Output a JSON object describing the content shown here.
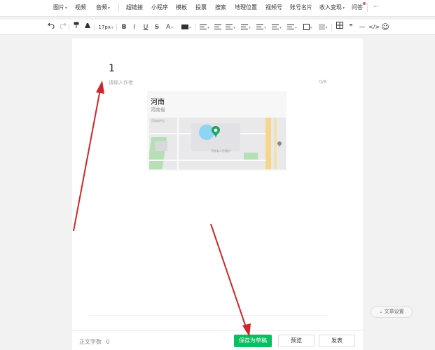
{
  "menu": {
    "items": [
      {
        "label": "图片",
        "dropdown": true
      },
      {
        "label": "视频",
        "dropdown": false
      },
      {
        "label": "音频",
        "dropdown": true
      },
      {
        "label": "超链接",
        "dropdown": false
      },
      {
        "label": "小程序",
        "dropdown": false
      },
      {
        "label": "模板",
        "dropdown": false
      },
      {
        "label": "投票",
        "dropdown": false
      },
      {
        "label": "搜索",
        "dropdown": false
      },
      {
        "label": "地理位置",
        "dropdown": false
      },
      {
        "label": "视频号",
        "dropdown": false
      },
      {
        "label": "账号名片",
        "dropdown": false
      },
      {
        "label": "收入变现",
        "dropdown": true
      },
      {
        "label": "问答",
        "dropdown": false
      },
      {
        "label": "···",
        "dropdown": false
      }
    ]
  },
  "toolbar": {
    "undo_icon": "undo-icon",
    "redo_icon": "redo-icon",
    "format_painter_icon": "format-painter-icon",
    "clear_format_icon": "clear-format-icon",
    "font_size": "17px",
    "bold": "B",
    "italic": "I",
    "underline": "U",
    "strike": "S",
    "font_color": "A",
    "quote": "❞",
    "dash": "—",
    "code": "</>",
    "emoji": "☺"
  },
  "editor": {
    "title": "1",
    "author_placeholder": "请输入作者",
    "author_count": "0/8"
  },
  "location_card": {
    "name": "河南",
    "subtitle": "河南省",
    "map_labels": [
      "河南省中心",
      "河南省人民政府"
    ]
  },
  "bottom": {
    "word_count_label": "正文字数",
    "word_count": "0",
    "save_draft": "保存为草稿",
    "preview": "预览",
    "publish": "发表"
  },
  "side": {
    "article_settings": "文章设置"
  },
  "colors": {
    "primary": "#07c160",
    "annotation_arrow": "#d0262b",
    "notice_dot": "#fa5151"
  }
}
